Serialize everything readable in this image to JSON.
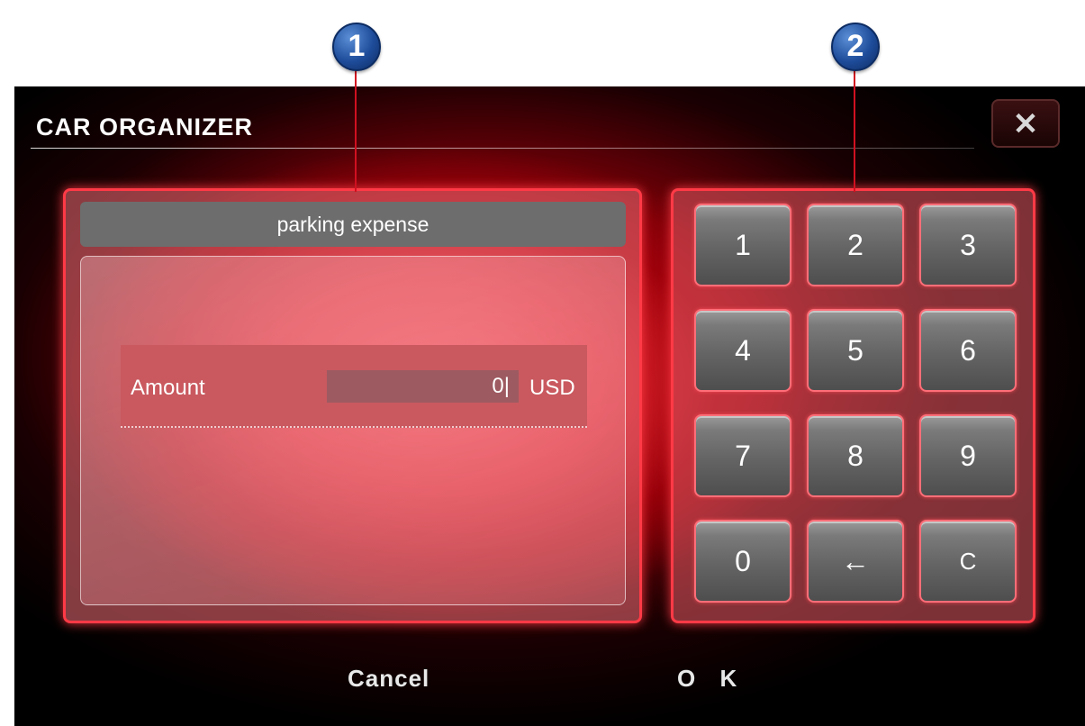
{
  "callouts": [
    {
      "number": "1"
    },
    {
      "number": "2"
    }
  ],
  "app": {
    "title": "CAR ORGANIZER",
    "close_icon": "close-icon",
    "close_label": "✕"
  },
  "expense": {
    "header": "parking expense",
    "amount_label": "Amount",
    "amount_value": "0|",
    "currency": "USD"
  },
  "keypad": {
    "keys": [
      "1",
      "2",
      "3",
      "4",
      "5",
      "6",
      "7",
      "8",
      "9",
      "0",
      "←",
      "C"
    ]
  },
  "footer": {
    "cancel_label": "Cancel",
    "ok_label": "O K"
  },
  "colors": {
    "accent": "#ff3a46",
    "callout": "#1e4c9a",
    "panel_header": "#6d6d6d"
  }
}
